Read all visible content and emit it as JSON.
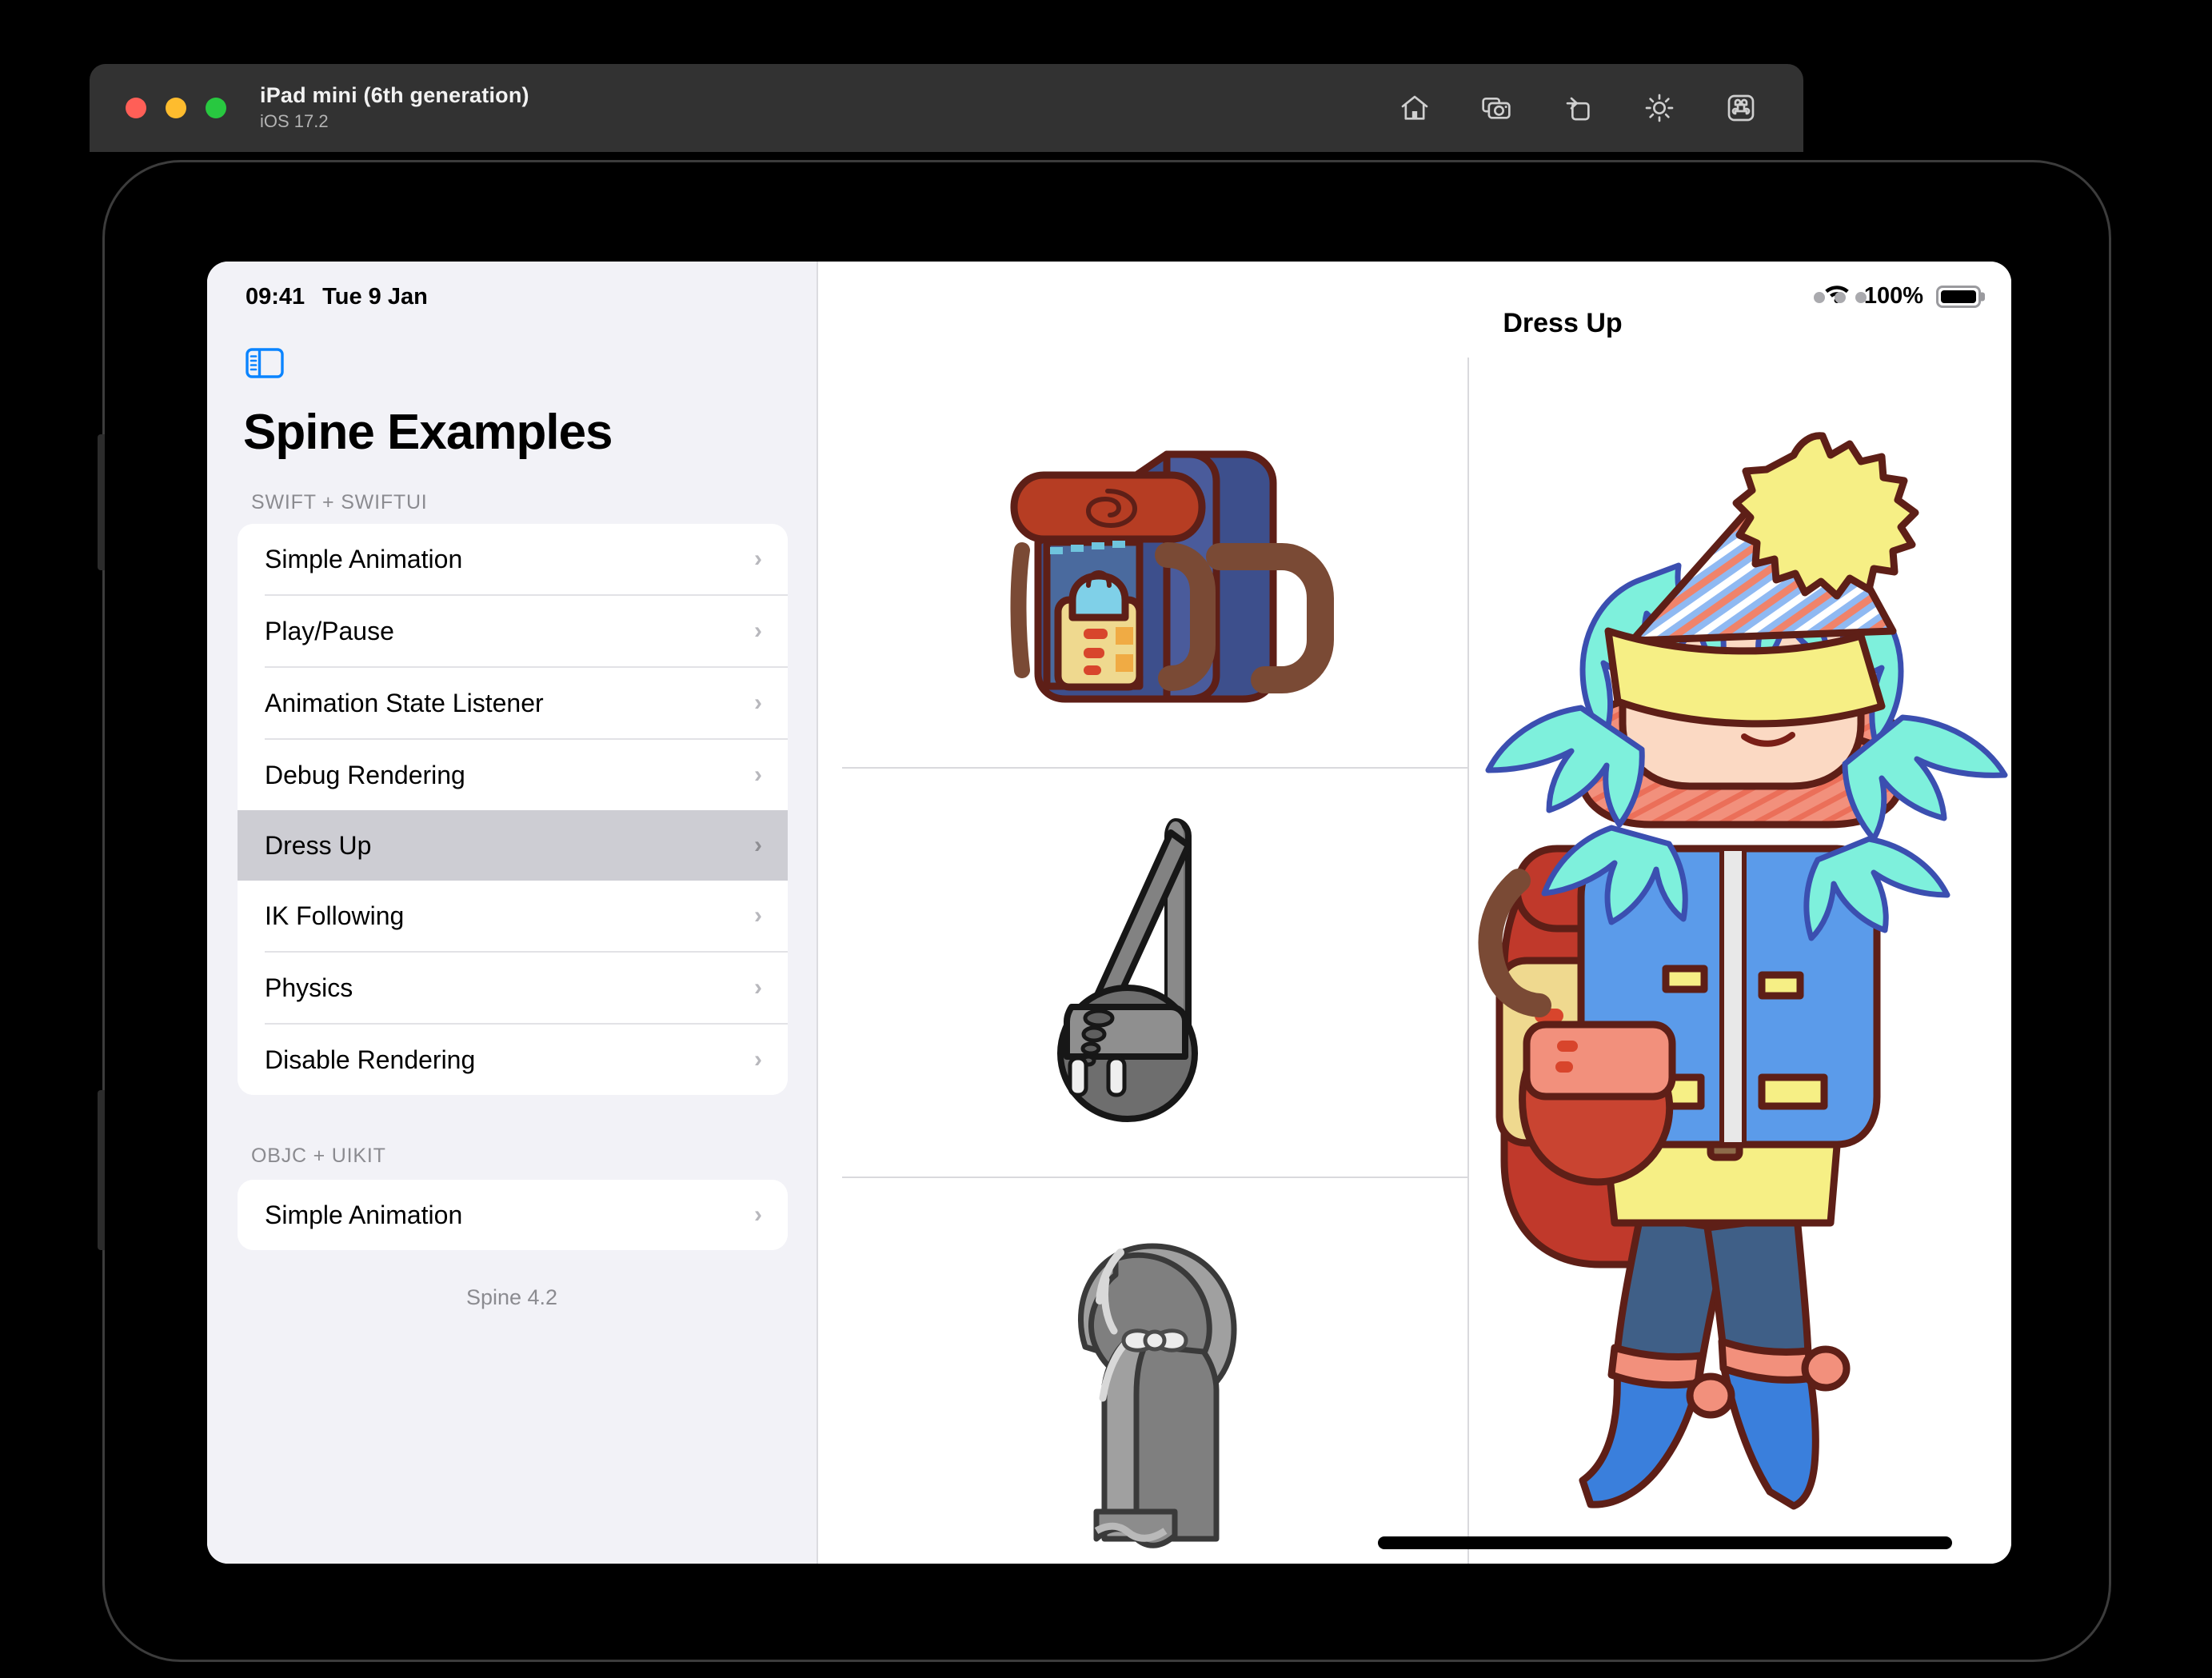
{
  "simulator": {
    "device_name": "iPad mini (6th generation)",
    "os_version": "iOS 17.2",
    "window_controls": [
      "close",
      "minimize",
      "zoom"
    ],
    "toolbar_icons": [
      "home-icon",
      "screenshot-icon",
      "rotate-icon",
      "appearance-icon",
      "keyboard-shortcut-icon"
    ]
  },
  "status_bar": {
    "time": "09:41",
    "date": "Tue 9 Jan",
    "wifi_icon": "wifi-icon",
    "battery_percent": "100%",
    "battery_icon": "battery-full-icon"
  },
  "sidebar": {
    "toggle_icon": "sidebar-toggle-icon",
    "title": "Spine Examples",
    "sections": [
      {
        "header": "SWIFT + SWIFTUI",
        "items": [
          {
            "label": "Simple Animation",
            "selected": false
          },
          {
            "label": "Play/Pause",
            "selected": false
          },
          {
            "label": "Animation State Listener",
            "selected": false
          },
          {
            "label": "Debug Rendering",
            "selected": false
          },
          {
            "label": "Dress Up",
            "selected": true
          },
          {
            "label": "IK Following",
            "selected": false
          },
          {
            "label": "Physics",
            "selected": false
          },
          {
            "label": "Disable Rendering",
            "selected": false
          }
        ]
      },
      {
        "header": "OBJC + UIKIT",
        "items": [
          {
            "label": "Simple Animation",
            "selected": false
          }
        ]
      }
    ],
    "footer": "Spine 4.2",
    "chevron_glyph": "›"
  },
  "detail": {
    "title": "Dress Up",
    "drag_handle_icon": "drag-dots-icon",
    "items": [
      {
        "name": "backpack",
        "state": "equipped",
        "colors": {
          "body": "#3d4f8c",
          "roll": "#b63d23",
          "strap": "#7a4a35",
          "outline": "#5e1f17"
        }
      },
      {
        "name": "crossbody-bag",
        "state": "not-equipped",
        "colors": {
          "body": "#6e6e6e",
          "strap": "#7d7d7d",
          "outline": "#171717"
        }
      },
      {
        "name": "hooded-cape",
        "state": "not-equipped",
        "colors": {
          "body": "#7f7f7f",
          "lining": "#cfcfcf",
          "outline": "#3a3a3a"
        }
      }
    ],
    "character": {
      "name": "dress-up-girl",
      "hat": {
        "cone_color": "#8fb9f2",
        "stripe_color": "#f0836a",
        "band_color": "#f6ef85",
        "pompom_color": "#f6ef85"
      },
      "hair_color": "#7ef0dc",
      "scarf_color": "#f2907c",
      "jacket_color": "#5b9bea",
      "pocket_color": "#f6ef85",
      "jeans_color": "#3f5f87",
      "boots_color": "#3a7fdc",
      "boot_trim_color": "#f2907c",
      "backpack_color": "#c0392b",
      "skirt_color": "#f6ef85"
    },
    "home_indicator": "home-indicator"
  },
  "colors": {
    "sidebar_background": "#f2f2f7",
    "card_background": "#ffffff",
    "selection": "#cdcdd3",
    "accent_blue": "#0a84ff",
    "secondary_text": "#8b8b90",
    "divider": "#e2e2e6",
    "titlebar": "#323232"
  }
}
